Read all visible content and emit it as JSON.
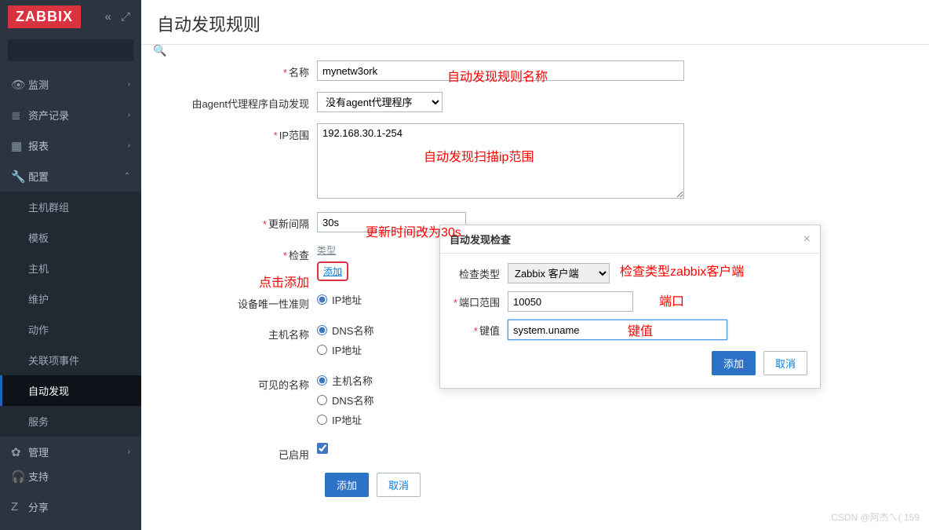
{
  "logo": "ZABBIX",
  "sidebar": {
    "search_placeholder": "",
    "items": [
      {
        "icon": "👁",
        "label": "监测",
        "expand": "›"
      },
      {
        "icon": "≣",
        "label": "资产记录",
        "expand": "›"
      },
      {
        "icon": "▦",
        "label": "报表",
        "expand": "›"
      },
      {
        "icon": "🔧",
        "label": "配置",
        "expand": "⌃"
      }
    ],
    "config_sub": [
      "主机群组",
      "模板",
      "主机",
      "维护",
      "动作",
      "关联项事件",
      "自动发现",
      "服务"
    ],
    "active_sub": "自动发现",
    "admin": {
      "icon": "✿",
      "label": "管理",
      "expand": "›"
    },
    "footer": [
      {
        "icon": "🎧",
        "label": "支持"
      },
      {
        "icon": "Z",
        "label": "分享"
      }
    ]
  },
  "page": {
    "title": "自动发现规则"
  },
  "form": {
    "name_label": "名称",
    "name_value": "mynetw3ork",
    "proxy_label": "由agent代理程序自动发现",
    "proxy_value": "没有agent代理程序",
    "iprange_label": "IP范围",
    "iprange_value": "192.168.30.1-254",
    "interval_label": "更新间隔",
    "interval_value": "30s",
    "check_label": "检查",
    "check_type_head": "类型",
    "check_add": "添加",
    "unique_label": "设备唯一性准则",
    "unique_opts": [
      "IP地址"
    ],
    "hostname_label": "主机名称",
    "hostname_opts": [
      "DNS名称",
      "IP地址"
    ],
    "visible_label": "可见的名称",
    "visible_opts": [
      "主机名称",
      "DNS名称",
      "IP地址"
    ],
    "enabled_label": "已启用",
    "btn_add": "添加",
    "btn_cancel": "取消"
  },
  "modal": {
    "title": "自动发现检查",
    "type_label": "检查类型",
    "type_value": "Zabbix 客户端",
    "port_label": "端口范围",
    "port_value": "10050",
    "key_label": "键值",
    "key_value": "system.uname",
    "btn_add": "添加",
    "btn_cancel": "取消"
  },
  "annotations": {
    "a1": "自动发现规则名称",
    "a2": "自动发现扫描ip范围",
    "a3": "更新时间改为30s",
    "a4": "点击添加",
    "a5": "检查类型zabbix客户端",
    "a6": "端口",
    "a7": "键值"
  },
  "watermark": "CSDN @阿杰ㄟ( 159"
}
